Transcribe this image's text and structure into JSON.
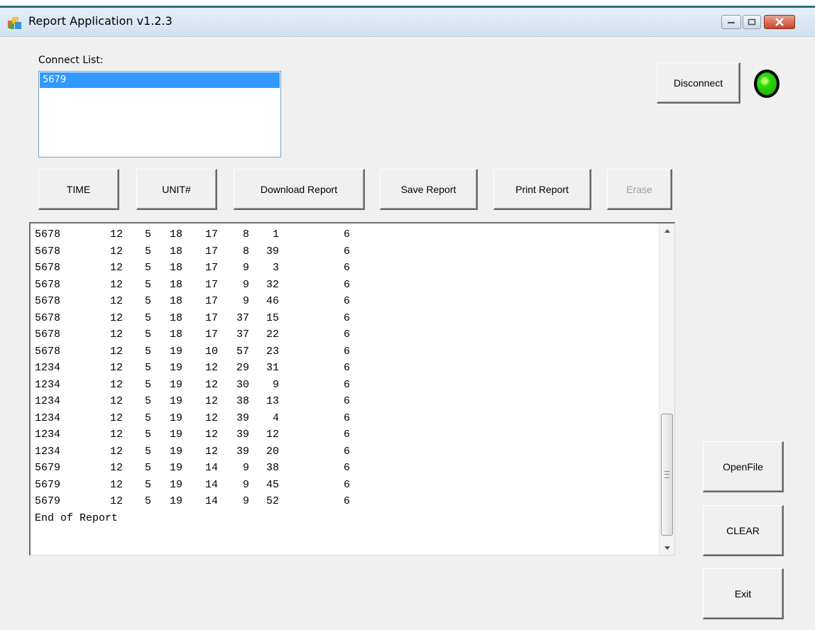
{
  "window": {
    "title": "Report Application v1.2.3"
  },
  "connect_list": {
    "label": "Connect List:",
    "items": [
      "5679"
    ],
    "selected": "5679"
  },
  "buttons": {
    "disconnect": "Disconnect",
    "time": "TIME",
    "unit": "UNIT#",
    "download_report": "Download Report",
    "save_report": "Save Report",
    "print_report": "Print Report",
    "erase": "Erase",
    "open_file": "OpenFile",
    "clear": "CLEAR",
    "exit": "Exit"
  },
  "status": {
    "connected": true,
    "indicator_color": "#22cc00"
  },
  "report": {
    "rows": [
      [
        "5678",
        "12",
        "5",
        "18",
        "17",
        "8",
        "1",
        "6"
      ],
      [
        "5678",
        "12",
        "5",
        "18",
        "17",
        "8",
        "39",
        "6"
      ],
      [
        "5678",
        "12",
        "5",
        "18",
        "17",
        "9",
        "3",
        "6"
      ],
      [
        "5678",
        "12",
        "5",
        "18",
        "17",
        "9",
        "32",
        "6"
      ],
      [
        "5678",
        "12",
        "5",
        "18",
        "17",
        "9",
        "46",
        "6"
      ],
      [
        "5678",
        "12",
        "5",
        "18",
        "17",
        "37",
        "15",
        "6"
      ],
      [
        "5678",
        "12",
        "5",
        "18",
        "17",
        "37",
        "22",
        "6"
      ],
      [
        "5678",
        "12",
        "5",
        "19",
        "10",
        "57",
        "23",
        "6"
      ],
      [
        "1234",
        "12",
        "5",
        "19",
        "12",
        "29",
        "31",
        "6"
      ],
      [
        "1234",
        "12",
        "5",
        "19",
        "12",
        "30",
        "9",
        "6"
      ],
      [
        "1234",
        "12",
        "5",
        "19",
        "12",
        "38",
        "13",
        "6"
      ],
      [
        "1234",
        "12",
        "5",
        "19",
        "12",
        "39",
        "4",
        "6"
      ],
      [
        "1234",
        "12",
        "5",
        "19",
        "12",
        "39",
        "12",
        "6"
      ],
      [
        "1234",
        "12",
        "5",
        "19",
        "12",
        "39",
        "20",
        "6"
      ],
      [
        "5679",
        "12",
        "5",
        "19",
        "14",
        "9",
        "38",
        "6"
      ],
      [
        "5679",
        "12",
        "5",
        "19",
        "14",
        "9",
        "45",
        "6"
      ],
      [
        "5679",
        "12",
        "5",
        "19",
        "14",
        "9",
        "52",
        "6"
      ]
    ],
    "footer": "End of Report"
  }
}
